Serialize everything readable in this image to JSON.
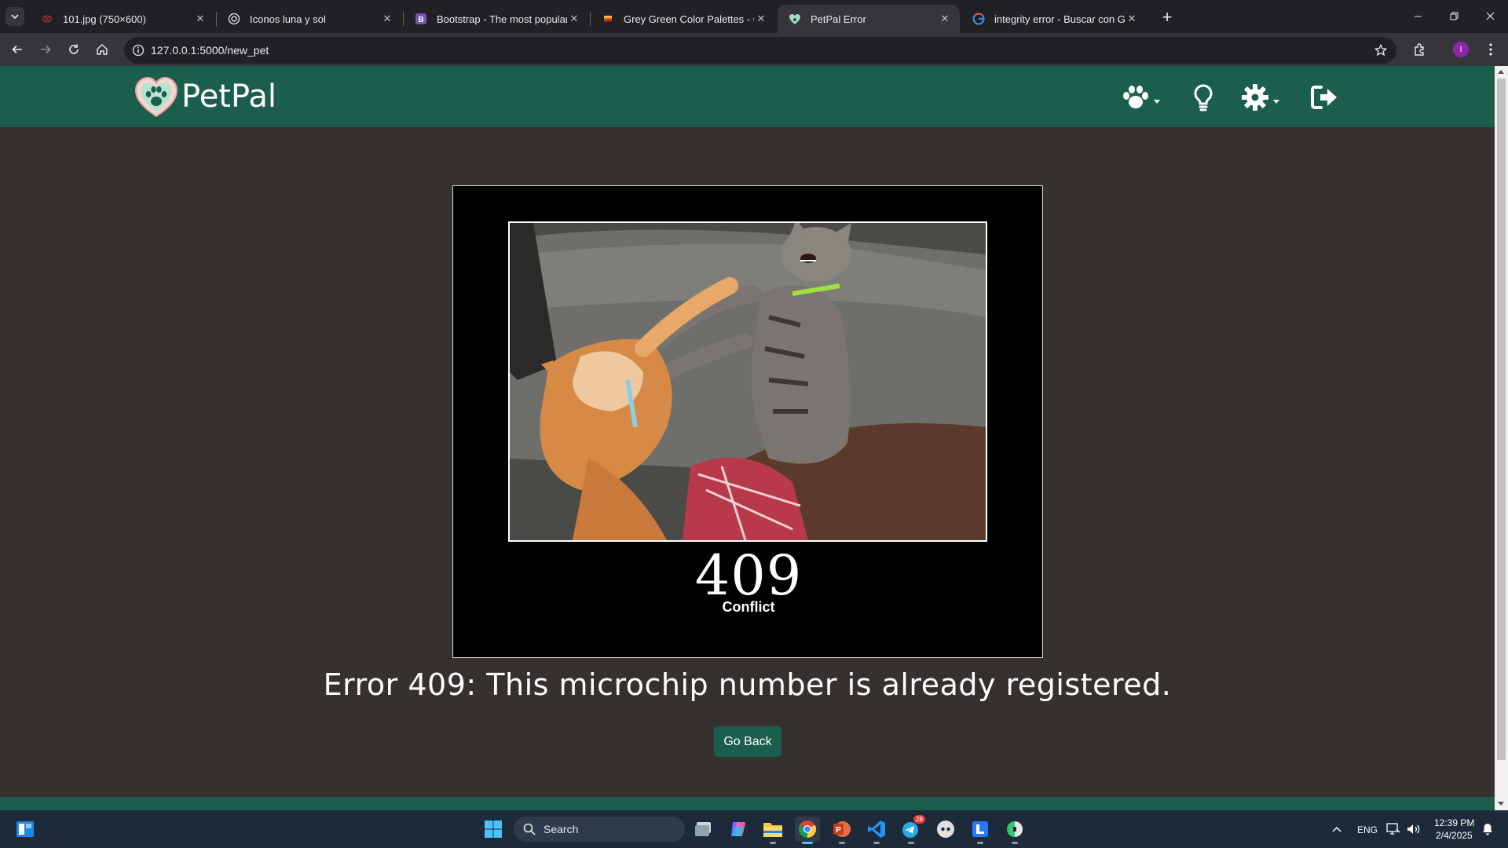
{
  "browser": {
    "tabs": [
      {
        "title": "101.jpg (750×600)",
        "active": false
      },
      {
        "title": "Iconos luna y sol",
        "active": false
      },
      {
        "title": "Bootstrap - The most popular H",
        "active": false
      },
      {
        "title": "Grey Green Color Palettes - Col",
        "active": false
      },
      {
        "title": "PetPal Error",
        "active": true
      },
      {
        "title": "integrity error - Buscar con Goo",
        "active": false
      }
    ],
    "url": "127.0.0.1:5000/new_pet",
    "profile_initial": "I"
  },
  "site": {
    "brand": "PetPal",
    "nav_icons": [
      "paw-icon",
      "lightbulb-icon",
      "gear-icon",
      "sign-out-icon"
    ],
    "colors": {
      "header": "#1b5e4b",
      "body_bg": "#36312e"
    }
  },
  "error": {
    "code": "409",
    "label": "Conflict",
    "message": "Error 409: This microchip number is already registered.",
    "button": "Go Back"
  },
  "taskbar": {
    "search_label": "Search",
    "language": "ENG",
    "time": "12:39 PM",
    "date": "2/4/2025",
    "telegram_badge": "28"
  }
}
